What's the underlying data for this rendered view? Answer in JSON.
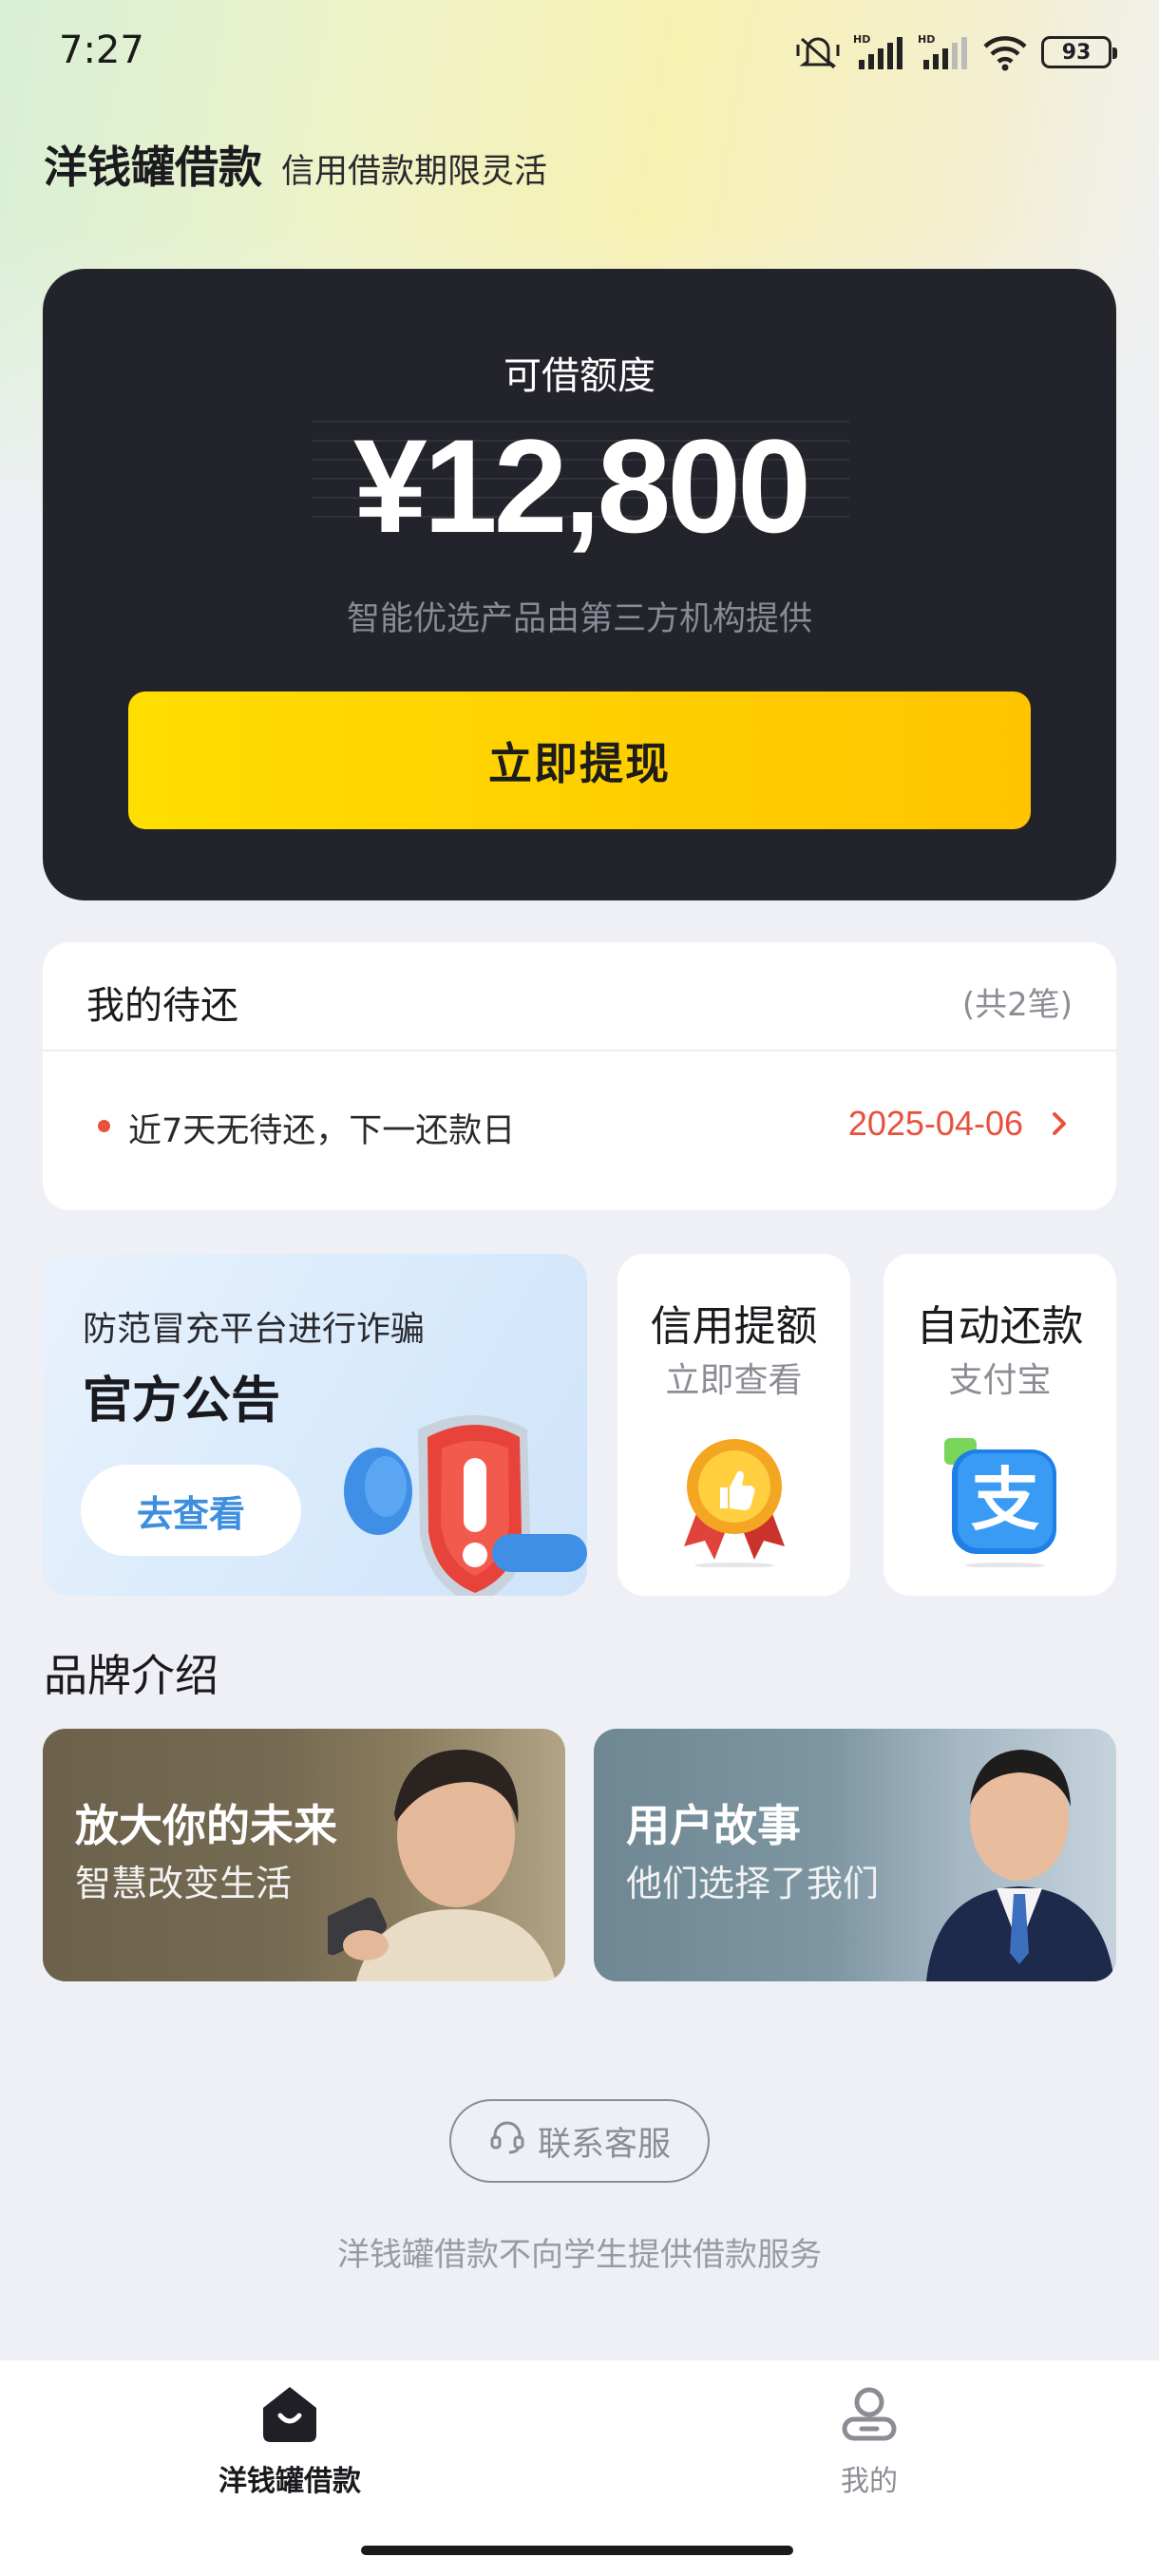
{
  "status_bar": {
    "time": "7:27",
    "battery": "93"
  },
  "header": {
    "title": "洋钱罐借款",
    "slogan": "信用借款期限灵活"
  },
  "credit": {
    "label": "可借额度",
    "amount": "¥12,800",
    "note": "智能优选产品由第三方机构提供",
    "button_label": "立即提现"
  },
  "repayment": {
    "title": "我的待还",
    "count": "(共2笔)",
    "message": "近7天无待还，下一还款日",
    "next_date": "2025-04-06"
  },
  "notice": {
    "subtitle": "防范冒充平台进行诈骗",
    "title": "官方公告",
    "button_label": "去查看"
  },
  "tiles": [
    {
      "title": "信用提额",
      "subtitle": "立即查看",
      "icon": "medal-icon"
    },
    {
      "title": "自动还款",
      "subtitle": "支付宝",
      "icon": "alipay-icon"
    }
  ],
  "brand": {
    "section_title": "品牌介绍",
    "cards": [
      {
        "title": "放大你的未来",
        "subtitle": "智慧改变生活"
      },
      {
        "title": "用户故事",
        "subtitle": "他们选择了我们"
      }
    ]
  },
  "footer": {
    "service_label": "联系客服",
    "disclaimer": "洋钱罐借款不向学生提供借款服务"
  },
  "nav": {
    "items": [
      {
        "label": "洋钱罐借款",
        "icon": "home-icon",
        "active": true
      },
      {
        "label": "我的",
        "icon": "profile-icon",
        "active": false
      }
    ]
  },
  "colors": {
    "accent_yellow": "#ffd000",
    "dark_card": "#23232c",
    "date_red": "#e8513d",
    "link_blue": "#3e8ee0"
  }
}
